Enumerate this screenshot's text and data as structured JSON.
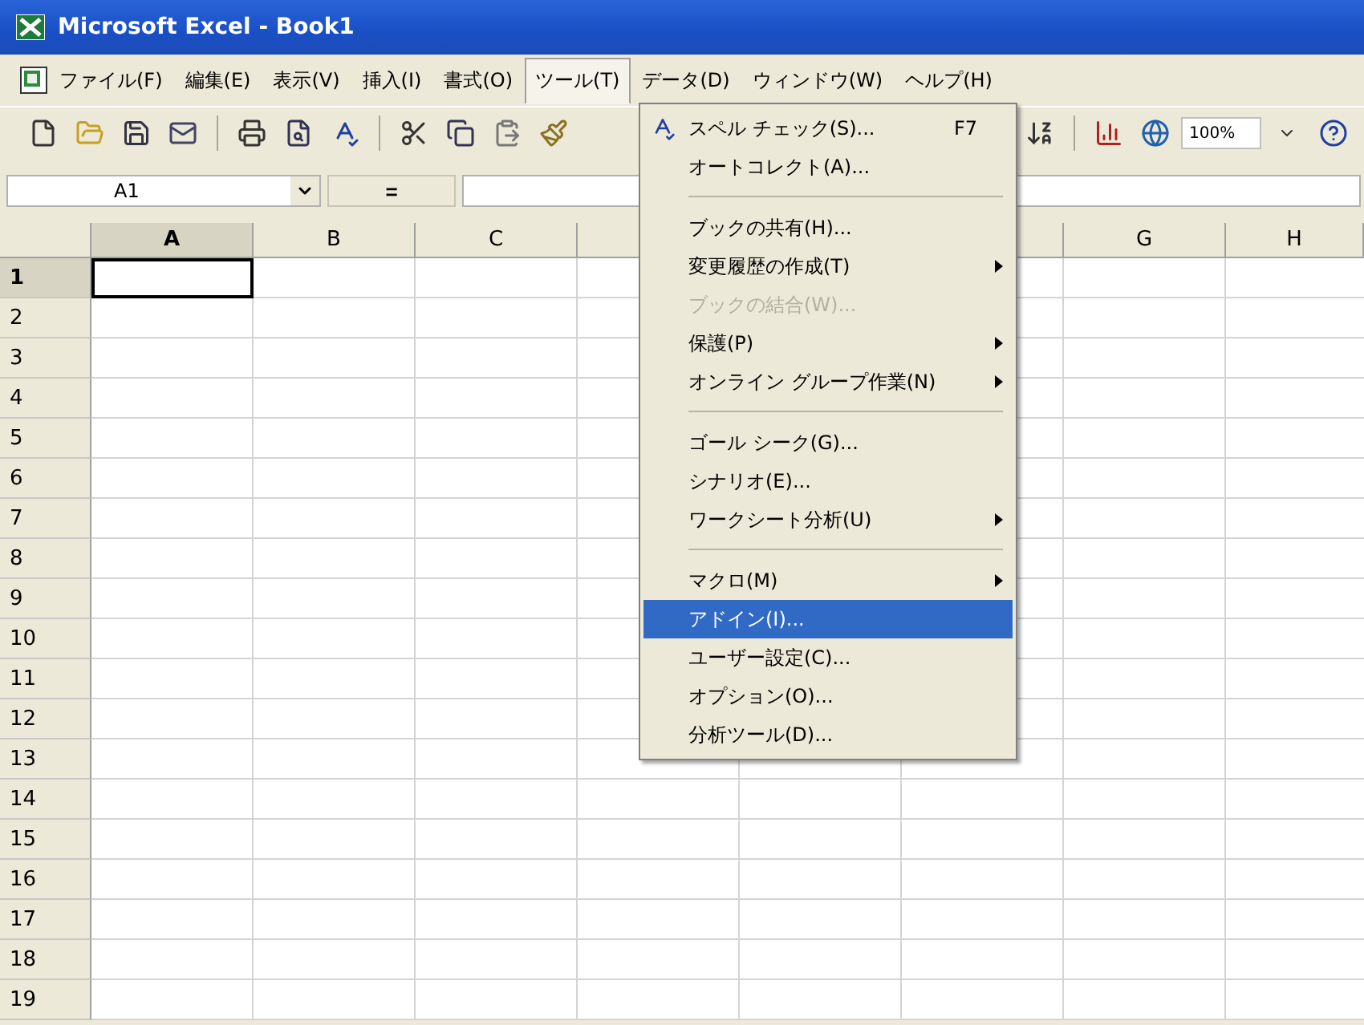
{
  "window": {
    "title": "Microsoft Excel - Book1"
  },
  "menu_bar": [
    {
      "label": "ファイル(F)",
      "selected": false
    },
    {
      "label": "編集(E)",
      "selected": false
    },
    {
      "label": "表示(V)",
      "selected": false
    },
    {
      "label": "挿入(I)",
      "selected": false
    },
    {
      "label": "書式(O)",
      "selected": false
    },
    {
      "label": "ツール(T)",
      "selected": true
    },
    {
      "label": "データ(D)",
      "selected": false
    },
    {
      "label": "ウィンドウ(W)",
      "selected": false
    },
    {
      "label": "ヘルプ(H)",
      "selected": false
    }
  ],
  "toolbar": {
    "zoom": "100%"
  },
  "formula_bar": {
    "name_box": "A1",
    "equals": "="
  },
  "sheet": {
    "columns": [
      {
        "label": "A",
        "active": true
      },
      {
        "label": "B",
        "active": false
      },
      {
        "label": "C",
        "active": false
      },
      {
        "active": false
      },
      null,
      {
        "active": false
      },
      {
        "label": "G",
        "active": false
      },
      {
        "label": "H",
        "active": false
      }
    ],
    "rows": [
      {
        "label": "1",
        "active": true
      },
      {
        "label": "2",
        "active": false
      },
      {
        "label": "3",
        "active": false
      },
      {
        "label": "4",
        "active": false
      },
      {
        "label": "5",
        "active": false
      },
      {
        "label": "6",
        "active": false
      },
      {
        "label": "7",
        "active": false
      },
      {
        "label": "8",
        "active": false
      },
      {
        "label": "9",
        "active": false
      },
      {
        "label": "10",
        "active": false
      },
      {
        "label": "11",
        "active": false
      },
      {
        "label": "12",
        "active": false
      },
      {
        "label": "13",
        "active": false
      },
      {
        "label": "14",
        "active": false
      },
      {
        "label": "15",
        "active": false
      },
      {
        "label": "16",
        "active": false
      },
      {
        "label": "17",
        "active": false
      },
      {
        "label": "18",
        "active": false
      },
      {
        "label": "19",
        "active": false
      }
    ]
  },
  "tools_menu": [
    {
      "kind": "item",
      "label": "スペル チェック(S)...",
      "shortcut": "F7",
      "icon": true,
      "selected": false,
      "disabled": false,
      "submenu": false
    },
    {
      "kind": "item",
      "label": "オートコレクト(A)...",
      "selected": false,
      "disabled": false,
      "submenu": false
    },
    {
      "kind": "separator"
    },
    {
      "kind": "item",
      "label": "ブックの共有(H)...",
      "selected": false,
      "disabled": false,
      "submenu": false
    },
    {
      "kind": "item",
      "label": "変更履歴の作成(T)",
      "selected": false,
      "disabled": false,
      "submenu": true
    },
    {
      "kind": "item",
      "label": "ブックの結合(W)...",
      "selected": false,
      "disabled": true,
      "submenu": false
    },
    {
      "kind": "item",
      "label": "保護(P)",
      "selected": false,
      "disabled": false,
      "submenu": true
    },
    {
      "kind": "item",
      "label": "オンライン グループ作業(N)",
      "selected": false,
      "disabled": false,
      "submenu": true
    },
    {
      "kind": "separator"
    },
    {
      "kind": "item",
      "label": "ゴール シーク(G)...",
      "selected": false,
      "disabled": false,
      "submenu": false
    },
    {
      "kind": "item",
      "label": "シナリオ(E)...",
      "selected": false,
      "disabled": false,
      "submenu": false
    },
    {
      "kind": "item",
      "label": "ワークシート分析(U)",
      "selected": false,
      "disabled": false,
      "submenu": true
    },
    {
      "kind": "separator"
    },
    {
      "kind": "item",
      "label": "マクロ(M)",
      "selected": false,
      "disabled": false,
      "submenu": true
    },
    {
      "kind": "item",
      "label": "アドイン(I)...",
      "selected": true,
      "disabled": false,
      "submenu": false
    },
    {
      "kind": "item",
      "label": "ユーザー設定(C)...",
      "selected": false,
      "disabled": false,
      "submenu": false
    },
    {
      "kind": "item",
      "label": "オプション(O)...",
      "selected": false,
      "disabled": false,
      "submenu": false
    },
    {
      "kind": "item",
      "label": "分析ツール(D)...",
      "selected": false,
      "disabled": false,
      "submenu": false
    }
  ]
}
